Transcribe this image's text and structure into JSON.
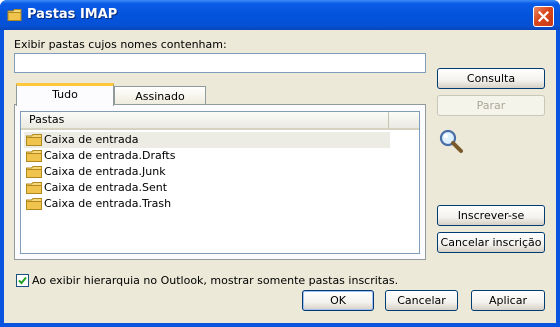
{
  "window": {
    "title": "Pastas IMAP"
  },
  "filter": {
    "label": "Exibir pastas cujos nomes contenham:",
    "value": "",
    "placeholder": ""
  },
  "tabs": [
    {
      "label": "Tudo",
      "active": true
    },
    {
      "label": "Assinado",
      "active": false
    }
  ],
  "list": {
    "header": "Pastas",
    "rows": [
      {
        "label": "Caixa de entrada",
        "selected": true
      },
      {
        "label": "Caixa de entrada.Drafts",
        "selected": false
      },
      {
        "label": "Caixa de entrada.Junk",
        "selected": false
      },
      {
        "label": "Caixa de entrada.Sent",
        "selected": false
      },
      {
        "label": "Caixa de entrada.Trash",
        "selected": false
      }
    ]
  },
  "side_buttons": {
    "consulta": "Consulta",
    "parar": "Parar",
    "inscrever": "Inscrever-se",
    "cancelar_inscricao": "Cancelar inscrição"
  },
  "option": {
    "label": "Ao exibir hierarquia no Outlook, mostrar somente pastas inscritas.",
    "checked": true
  },
  "footer": {
    "ok": "OK",
    "cancel": "Cancelar",
    "apply": "Aplicar"
  },
  "icons": {
    "title": "folder-icon",
    "close": "close-icon",
    "search": "magnifier-icon",
    "row": "folder-icon",
    "check": "checkmark-icon"
  },
  "colors": {
    "titlebar": "#0453dc",
    "dialog_bg": "#ece9d8",
    "active_tab_accent": "#ffc83c",
    "close_button": "#d9461b"
  }
}
